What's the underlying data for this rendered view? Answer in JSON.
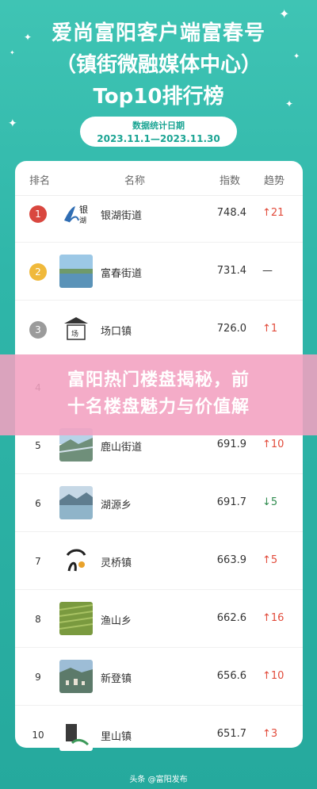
{
  "header": {
    "line1": "爱尚富阳客户端富春号",
    "line2": "（镇街微融媒体中心）",
    "line3": "Top10排行榜"
  },
  "date": {
    "label": "数据统计日期",
    "range": "2023.11.1—2023.11.30"
  },
  "table": {
    "columns": [
      "排名",
      "名称",
      "指数",
      "趋势"
    ],
    "rows": [
      {
        "rank": "1",
        "name": "银湖街道",
        "score": "748.4",
        "trend": "21",
        "dir": "up"
      },
      {
        "rank": "2",
        "name": "富春街道",
        "score": "731.4",
        "trend": "—",
        "dir": "flat"
      },
      {
        "rank": "3",
        "name": "场口镇",
        "score": "726.0",
        "trend": "1",
        "dir": "up"
      },
      {
        "rank": "4",
        "name": "",
        "score": "",
        "trend": "",
        "dir": "hidden"
      },
      {
        "rank": "5",
        "name": "鹿山街道",
        "score": "691.9",
        "trend": "10",
        "dir": "up"
      },
      {
        "rank": "6",
        "name": "湖源乡",
        "score": "691.7",
        "trend": "5",
        "dir": "down"
      },
      {
        "rank": "7",
        "name": "灵桥镇",
        "score": "663.9",
        "trend": "5",
        "dir": "up"
      },
      {
        "rank": "8",
        "name": "渔山乡",
        "score": "662.6",
        "trend": "16",
        "dir": "up"
      },
      {
        "rank": "9",
        "name": "新登镇",
        "score": "656.6",
        "trend": "10",
        "dir": "up"
      },
      {
        "rank": "10",
        "name": "里山镇",
        "score": "651.7",
        "trend": "3",
        "dir": "up"
      }
    ]
  },
  "banner": {
    "line1": "富阳热门楼盘揭秘，前",
    "line2": "十名楼盘魅力与价值解"
  },
  "footer": {
    "credit": "头条 @富阳发布"
  },
  "colors": {
    "background": "#2fb6a9",
    "accent": "#1aa493",
    "up": "#e24b3b",
    "down": "#2f8c4f",
    "gold": "#f0b93b",
    "red_medal": "#d9473f",
    "silver": "#9b9b9b",
    "banner": "#f2a0c0"
  }
}
